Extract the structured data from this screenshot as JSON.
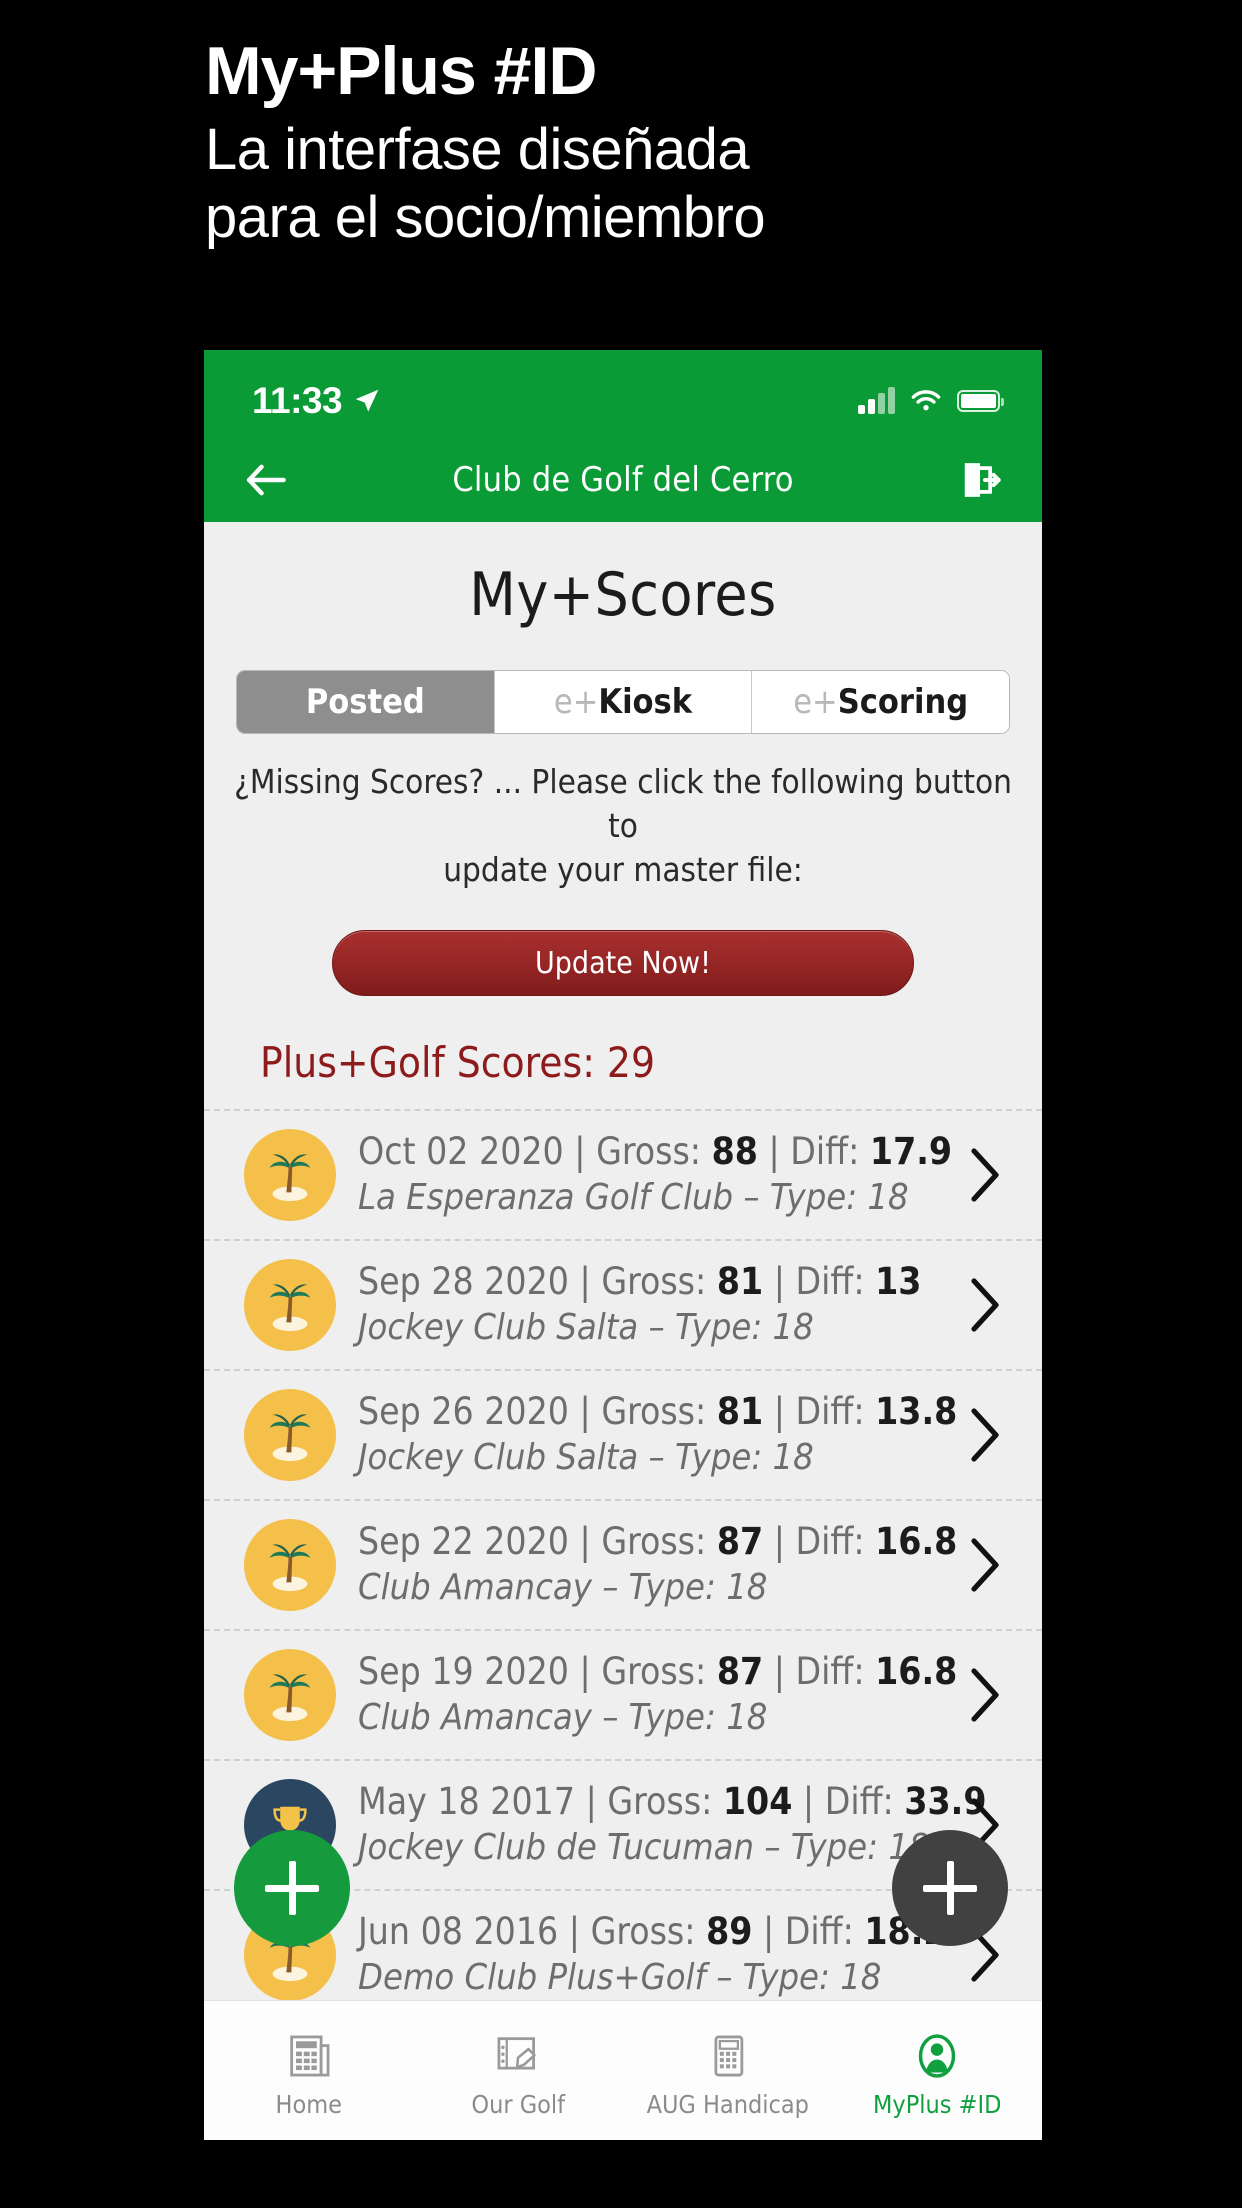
{
  "promo": {
    "title": "My+Plus #ID",
    "subtitle_line1": "La interfase diseñada",
    "subtitle_line2": "para el socio/miembro"
  },
  "status_bar": {
    "time": "11:33",
    "location_icon": "location-arrow-icon",
    "signal_icon": "cellular-signal-icon",
    "wifi_icon": "wifi-icon",
    "battery_icon": "battery-full-icon"
  },
  "navbar": {
    "back_icon": "back-arrow-icon",
    "title": "Club de Golf del Cerro",
    "logout_icon": "logout-icon"
  },
  "screen": {
    "title": "My+Scores"
  },
  "segmented": {
    "options": [
      {
        "pre": "",
        "post": "Posted",
        "active": true
      },
      {
        "pre": "e+",
        "post": "Kiosk",
        "active": false
      },
      {
        "pre": "e+",
        "post": "Scoring",
        "active": false
      }
    ]
  },
  "notice": {
    "line1": "¿Missing Scores? ... Please click the following button to",
    "line2": "update your master file:"
  },
  "update_button": {
    "label": "Update Now!",
    "color": "#942524"
  },
  "scores": {
    "header": "Plus+Golf Scores: 29",
    "header_color": "#8d1b1b",
    "count": 29,
    "rows": [
      {
        "icon": "palm-tree-icon",
        "icon_kind": "palm",
        "date": "Oct 02 2020",
        "gross_label": "Gross:",
        "gross": "88",
        "diff_label": "Diff:",
        "diff": "17.9",
        "course": "La Esperanza Golf Club",
        "type_label": "Type:",
        "type": "18",
        "chevron": "chevron-right-icon"
      },
      {
        "icon": "palm-tree-icon",
        "icon_kind": "palm",
        "date": "Sep 28 2020",
        "gross_label": "Gross:",
        "gross": "81",
        "diff_label": "Diff:",
        "diff": "13",
        "course": "Jockey Club Salta",
        "type_label": "Type:",
        "type": "18",
        "chevron": "chevron-right-icon"
      },
      {
        "icon": "palm-tree-icon",
        "icon_kind": "palm",
        "date": "Sep 26 2020",
        "gross_label": "Gross:",
        "gross": "81",
        "diff_label": "Diff:",
        "diff": "13.8",
        "course": "Jockey Club Salta",
        "type_label": "Type:",
        "type": "18",
        "chevron": "chevron-right-icon"
      },
      {
        "icon": "palm-tree-icon",
        "icon_kind": "palm",
        "date": "Sep 22 2020",
        "gross_label": "Gross:",
        "gross": "87",
        "diff_label": "Diff:",
        "diff": "16.8",
        "course": "Club Amancay",
        "type_label": "Type:",
        "type": "18",
        "chevron": "chevron-right-icon"
      },
      {
        "icon": "palm-tree-icon",
        "icon_kind": "palm",
        "date": "Sep 19 2020",
        "gross_label": "Gross:",
        "gross": "87",
        "diff_label": "Diff:",
        "diff": "16.8",
        "course": "Club Amancay",
        "type_label": "Type:",
        "type": "18",
        "chevron": "chevron-right-icon"
      },
      {
        "icon": "trophy-icon",
        "icon_kind": "trophy",
        "date": "May 18 2017",
        "gross_label": "Gross:",
        "gross": "104",
        "diff_label": "Diff:",
        "diff": "33.9",
        "course": "Jockey Club de Tucuman",
        "type_label": "Type:",
        "type": "18",
        "chevron": "chevron-right-icon"
      },
      {
        "icon": "palm-tree-icon",
        "icon_kind": "palm",
        "date": "Jun 08 2016",
        "gross_label": "Gross:",
        "gross": "89",
        "diff_label": "Diff:",
        "diff": "18.2",
        "course": "Demo Club Plus+Golf",
        "type_label": "Type:",
        "type": "18",
        "chevron": "chevron-right-icon"
      }
    ]
  },
  "fabs": [
    {
      "name": "add-score-fab",
      "icon": "plus-icon",
      "color": "#159a3e"
    },
    {
      "name": "add-action-fab",
      "icon": "plus-icon",
      "color": "#414141"
    }
  ],
  "tabbar": {
    "items": [
      {
        "label": "Home",
        "icon": "news-icon",
        "active": false
      },
      {
        "label": "Our Golf",
        "icon": "scorecard-pencil-icon",
        "active": false
      },
      {
        "label": "AUG Handicap",
        "icon": "calculator-icon",
        "active": false
      },
      {
        "label": "MyPlus #ID",
        "icon": "user-profile-icon",
        "active": true
      }
    ],
    "active_color": "#11a03f"
  }
}
